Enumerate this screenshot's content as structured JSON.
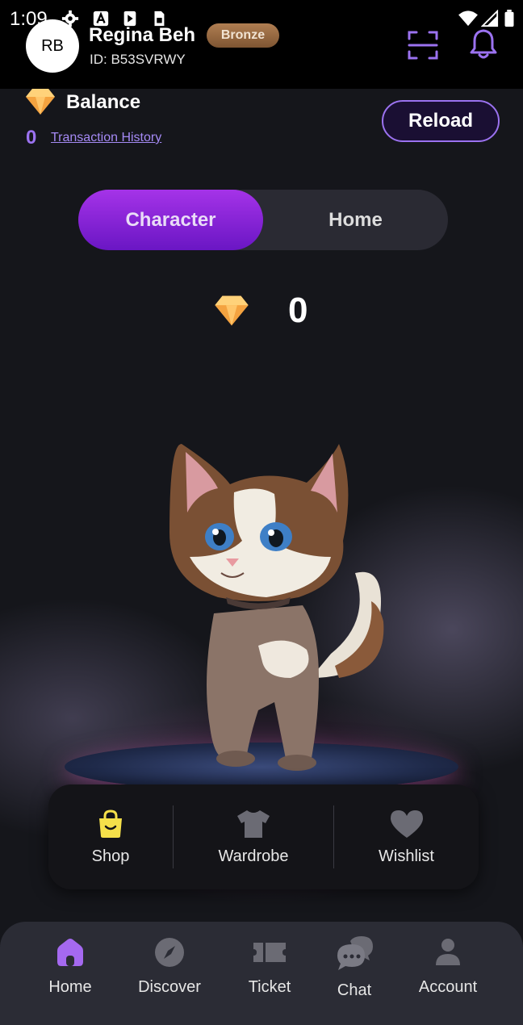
{
  "status_bar": {
    "time": "1:09"
  },
  "profile": {
    "initials": "RB",
    "name": "Regina Beh",
    "tier": "Bronze",
    "id_text": "ID: B53SVRWY"
  },
  "balance": {
    "label": "Balance",
    "amount": "0",
    "history_link": "Transaction History",
    "reload_label": "Reload"
  },
  "toggle": {
    "options": [
      "Character",
      "Home"
    ],
    "selected": "Character"
  },
  "gems": {
    "count": "0"
  },
  "actions": [
    {
      "label": "Shop",
      "icon": "shopping-bag-icon"
    },
    {
      "label": "Wardrobe",
      "icon": "shirt-icon"
    },
    {
      "label": "Wishlist",
      "icon": "heart-icon"
    }
  ],
  "bottom_nav": {
    "items": [
      {
        "label": "Home",
        "icon": "home-icon",
        "active": true
      },
      {
        "label": "Discover",
        "icon": "compass-icon",
        "active": false
      },
      {
        "label": "Ticket",
        "icon": "ticket-icon",
        "active": false
      },
      {
        "label": "Chat",
        "icon": "chat-icon",
        "active": false
      },
      {
        "label": "Account",
        "icon": "account-icon",
        "active": false
      }
    ]
  },
  "colors": {
    "accent_purple": "#9b72f0",
    "toggle_active": "#8a2be2",
    "shop_yellow": "#f5e04a",
    "nav_active": "#a569f0",
    "bronze": "#a0724a"
  }
}
